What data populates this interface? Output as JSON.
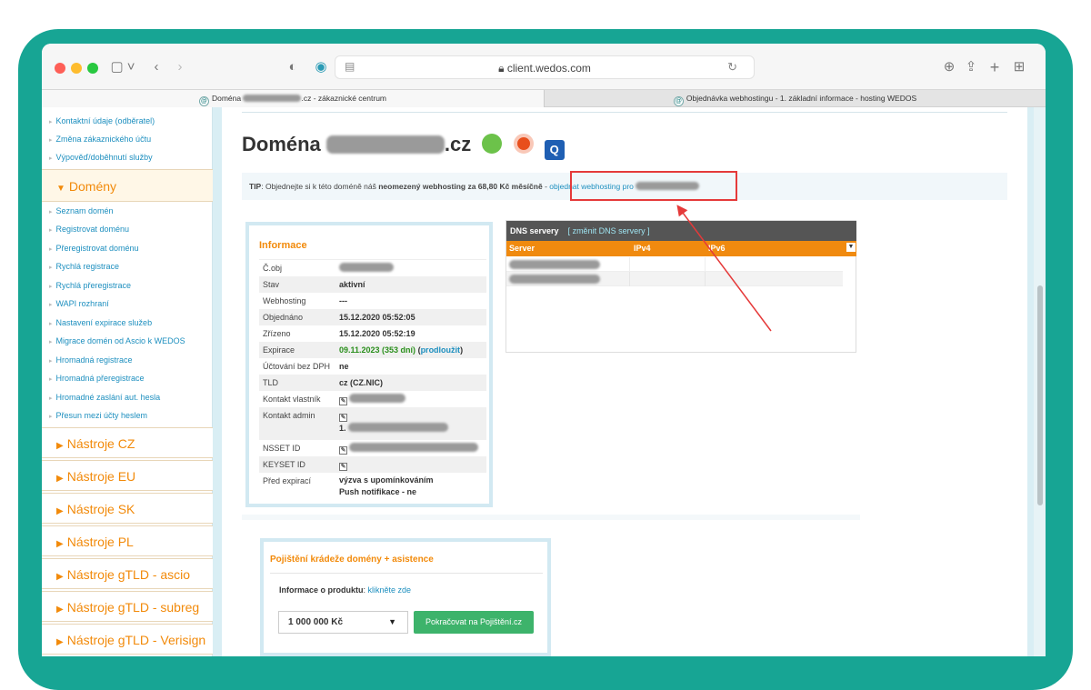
{
  "browser": {
    "url": "client.wedos.com",
    "tabs": [
      {
        "label_prefix": "Doména ",
        "label_suffix": ".cz - zákaznické centrum",
        "active": true
      },
      {
        "label": "Objednávka webhostingu - 1. základní informace - hosting WEDOS",
        "active": false
      }
    ]
  },
  "sidebar": {
    "top_links": [
      "Kontaktní údaje (odběratel)",
      "Změna zákaznického účtu",
      "Výpověď/doběhnutí služby"
    ],
    "domains_section": "Domény",
    "domain_links": [
      "Seznam domén",
      "Registrovat doménu",
      "Přeregistrovat doménu",
      "Rychlá registrace",
      "Rychlá přeregistrace",
      "WAPI rozhraní",
      "Nastavení expirace služeb",
      "Migrace domén od Ascio k WEDOS",
      "Hromadná registrace",
      "Hromadná přeregistrace",
      "Hromadné zaslání aut. hesla",
      "Přesun mezi účty heslem"
    ],
    "tool_sections": [
      "Nástroje CZ",
      "Nástroje EU",
      "Nástroje SK",
      "Nástroje PL",
      "Nástroje gTLD - ascio",
      "Nástroje gTLD - subreg",
      "Nástroje gTLD - Verisign"
    ]
  },
  "heading": {
    "prefix": "Doména",
    "suffix": ".cz"
  },
  "tip": {
    "label": "TIP",
    "text": ": Objednejte si k této doméně náš ",
    "bold": "neomezený webhosting za 68,80 Kč měsíčně",
    "dash": " - ",
    "link": "objednat webhosting pro "
  },
  "info": {
    "title": "Informace",
    "rows": [
      {
        "label": "Č.obj",
        "value": ""
      },
      {
        "label": "Stav",
        "value": "aktivní"
      },
      {
        "label": "Webhosting",
        "value": "---"
      },
      {
        "label": "Objednáno",
        "value": "15.12.2020 05:52:05"
      },
      {
        "label": "Zřízeno",
        "value": "15.12.2020 05:52:19"
      },
      {
        "label": "Expirace",
        "value": "09.11.2023 (353 dní)",
        "extra_open": " (",
        "extra_link": "prodloužit",
        "extra_close": ")"
      },
      {
        "label": "Účtování bez DPH",
        "value": "ne"
      },
      {
        "label": "TLD",
        "value": "cz (CZ.NIC)"
      },
      {
        "label": "Kontakt vlastník",
        "value": ""
      },
      {
        "label": "Kontakt admin",
        "value": "1."
      },
      {
        "label": "NSSET ID",
        "value": ""
      },
      {
        "label": "KEYSET ID",
        "value": ""
      },
      {
        "label": "Před expirací",
        "value": "výzva s upomínkováním",
        "value2": "Push notifikace - ne"
      }
    ]
  },
  "dns": {
    "title": "DNS servery",
    "change_link": "[ změnit DNS servery ]",
    "columns": [
      "Server",
      "IPv4",
      "IPv6"
    ]
  },
  "insurance": {
    "title": "Pojištění krádeže domény + asistence",
    "info_label": "Informace o produktu",
    "info_link": "klikněte zde",
    "select_value": "1 000 000 Kč",
    "button": "Pokračovat na Pojištění.cz"
  },
  "colors": {
    "accent": "#f28a0a",
    "link": "#1d8fbf",
    "frame": "#17a594",
    "highlight": "#e53a3a",
    "button": "#3db36b"
  }
}
